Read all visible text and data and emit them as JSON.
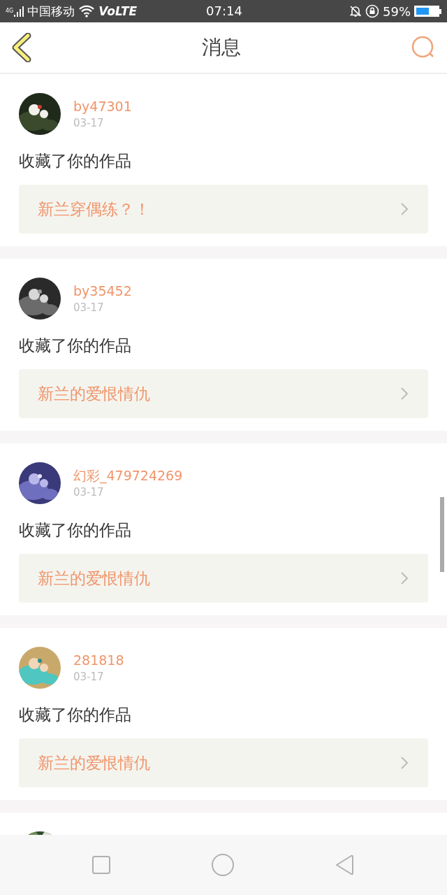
{
  "status_bar": {
    "network": "4G",
    "carrier": "中国移动",
    "volte": "VoLTE",
    "time": "07:14",
    "battery": "59%"
  },
  "header": {
    "title": "消息"
  },
  "messages": [
    {
      "user": "by47301",
      "date": "03-17",
      "action": "收藏了你的作品",
      "work": "新兰穿偶练？！"
    },
    {
      "user": "by35452",
      "date": "03-17",
      "action": "收藏了你的作品",
      "work": "新兰的爱恨情仇"
    },
    {
      "user": "幻彩_479724269",
      "date": "03-17",
      "action": "收藏了你的作品",
      "work": "新兰的爱恨情仇"
    },
    {
      "user": "281818",
      "date": "03-17",
      "action": "收藏了你的作品",
      "work": "新兰的爱恨情仇"
    }
  ]
}
